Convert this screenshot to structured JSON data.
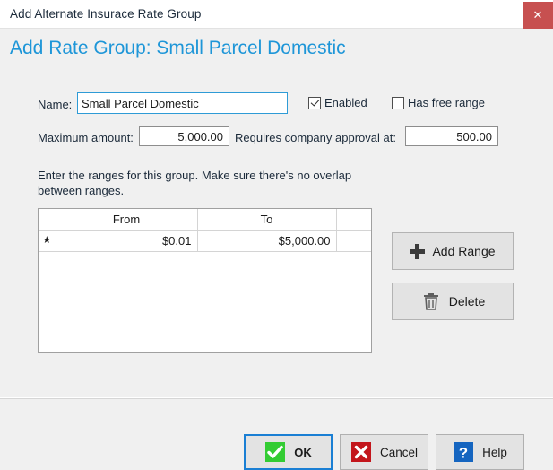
{
  "window": {
    "title": "Add Alternate Insurace Rate Group",
    "close_label": "✕"
  },
  "heading": "Add Rate Group: Small Parcel Domestic",
  "form": {
    "name_label": "Name:",
    "name_value": "Small Parcel Domestic",
    "name_placeholder": "",
    "enabled_label": "Enabled",
    "enabled_checked": true,
    "has_free_range_label": "Has free range",
    "has_free_range_checked": false,
    "maximum_amount_label": "Maximum amount:",
    "maximum_amount_value": "5,000.00",
    "approval_label": "Requires company approval at:",
    "approval_value": "500.00"
  },
  "instructions": "Enter the ranges for this group. Make sure there's no overlap between ranges.",
  "grid": {
    "row_header_glyph": "★",
    "columns": [
      "",
      "From",
      "To",
      ""
    ],
    "rows": [
      {
        "marker": "★",
        "from": "$0.01",
        "to": "$5,000.00"
      }
    ]
  },
  "side_buttons": {
    "add_range_label": "Add Range",
    "delete_label": "Delete"
  },
  "footer": {
    "ok_label": "OK",
    "cancel_label": "Cancel",
    "help_label": "Help"
  },
  "colors": {
    "heading_blue": "#1e96d8",
    "close_red": "#c75050",
    "focus_blue": "#1a7fd4",
    "ok_green": "#33cc33",
    "cancel_red": "#c3161c",
    "help_blue": "#1565c0",
    "body_bg": "#f0f0f0"
  }
}
